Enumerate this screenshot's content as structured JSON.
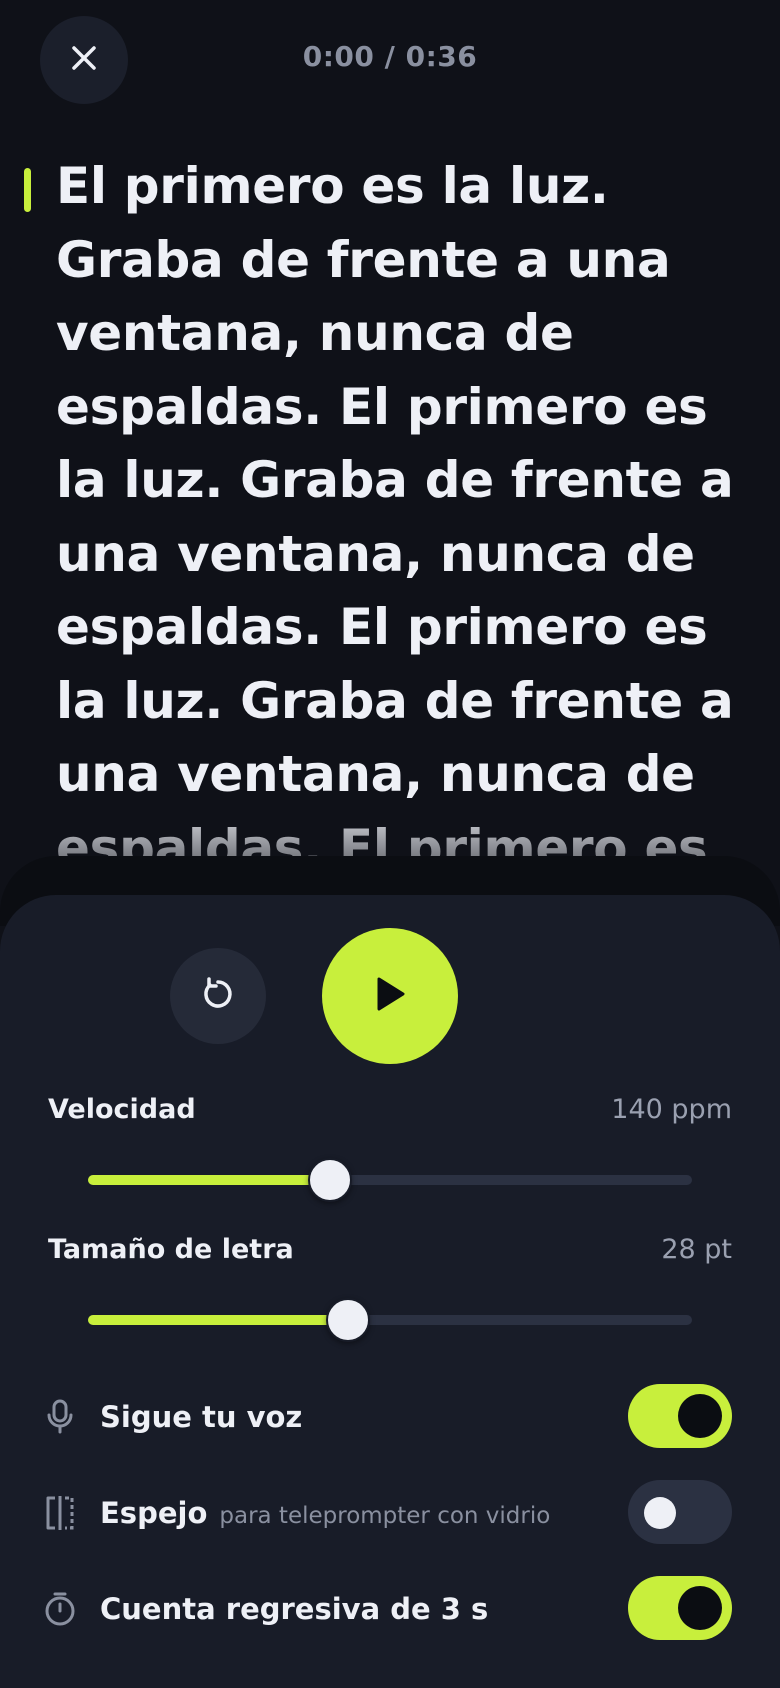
{
  "header": {
    "timer": "0:00 / 0:36",
    "close_icon": "close-icon"
  },
  "script": {
    "text": "El primero es la luz. Graba de frente a una ventana, nunca de espaldas. El primero es la luz. Graba de frente a una ventana, nunca de espaldas. El primero es la luz. Graba de frente a una ventana, nunca de espaldas. El primero es"
  },
  "controls": {
    "restart_icon": "restart-icon",
    "play_icon": "play-icon",
    "accent_color": "#c8ef3c",
    "speed": {
      "label": "Velocidad",
      "value_text": "140 ppm",
      "level": 0.4
    },
    "font_size": {
      "label": "Tamaño de letra",
      "value_text": "28 pt",
      "level": 0.43
    },
    "toggles": [
      {
        "label": "Sigue tu voz",
        "sublabel": "",
        "icon": "microphone-icon",
        "on": true
      },
      {
        "label": "Espejo",
        "sublabel": "para teleprompter con vidrio",
        "icon": "mirror-icon",
        "on": false
      },
      {
        "label": "Cuenta regresiva de 3 s",
        "sublabel": "",
        "icon": "timer-icon",
        "on": true
      }
    ]
  }
}
